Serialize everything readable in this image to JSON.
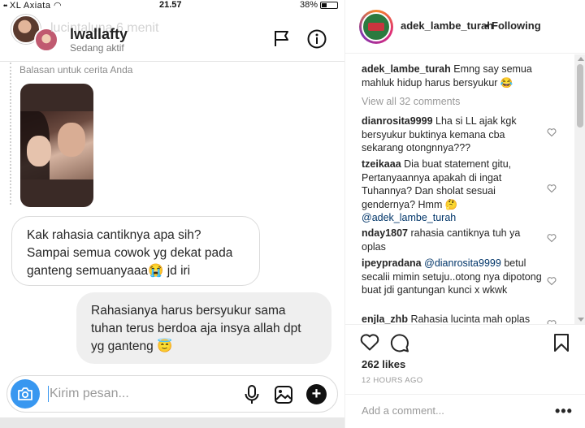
{
  "status_bar": {
    "carrier": "XL Axiata",
    "signal": "••",
    "wifi": "◠",
    "time": "21.57",
    "battery": "38%"
  },
  "dm": {
    "overlay_name": "lucintaluna  6 menit",
    "contact_name": "lwallafty",
    "active_status": "Sedang aktif",
    "reply_label": "Balasan untuk cerita Anda",
    "messages": [
      {
        "side": "in",
        "text": "Kak rahasia cantiknya apa sih? Sampai semua cowok yg dekat pada ganteng semuanyaaa😭 jd iri"
      },
      {
        "side": "out",
        "text": "Rahasianya harus bersyukur sama tuhan terus berdoa aja insya allah dpt yg ganteng 😇"
      }
    ],
    "composer_placeholder": "Kirim pesan..."
  },
  "post": {
    "username": "adek_lambe_turah",
    "dot": "•",
    "follow_status": "Following",
    "caption": {
      "user": "adek_lambe_turah",
      "text": "Emng say semua mahluk hidup harus bersyukur 😂"
    },
    "view_all": "View all 32 comments",
    "comments": [
      {
        "user": "dianrosita9999",
        "text": "Lha si LL ajak kgk bersyukur buktinya kemana cba sekarang otongnnya???",
        "mention": ""
      },
      {
        "user": "tzeikaaa",
        "text": "Dia buat statement gitu, Pertanyaannya apakah di ingat Tuhannya? Dan sholat sesuai gendernya? Hmm 🤔",
        "mention": "@adek_lambe_turah"
      },
      {
        "user": "nday1807",
        "text": "rahasia cantiknya tuh ya oplas",
        "mention": ""
      },
      {
        "user": "ipeypradana",
        "text": "betul secalii mimin setuju..otong nya dipotong buat jdi gantungan kunci x wkwk",
        "mention": "@dianrosita9999"
      },
      {
        "user": "enjla_zhb",
        "text": "Rahasia lucinta mah oplas",
        "mention": ""
      }
    ],
    "likes": "262 likes",
    "time": "12 HOURS AGO",
    "add_comment_placeholder": "Add a comment...",
    "more": "•••"
  },
  "colors": {
    "accent": "#3897f0",
    "bubble_out": "#efefef",
    "text": "#262626",
    "muted": "#999999"
  }
}
